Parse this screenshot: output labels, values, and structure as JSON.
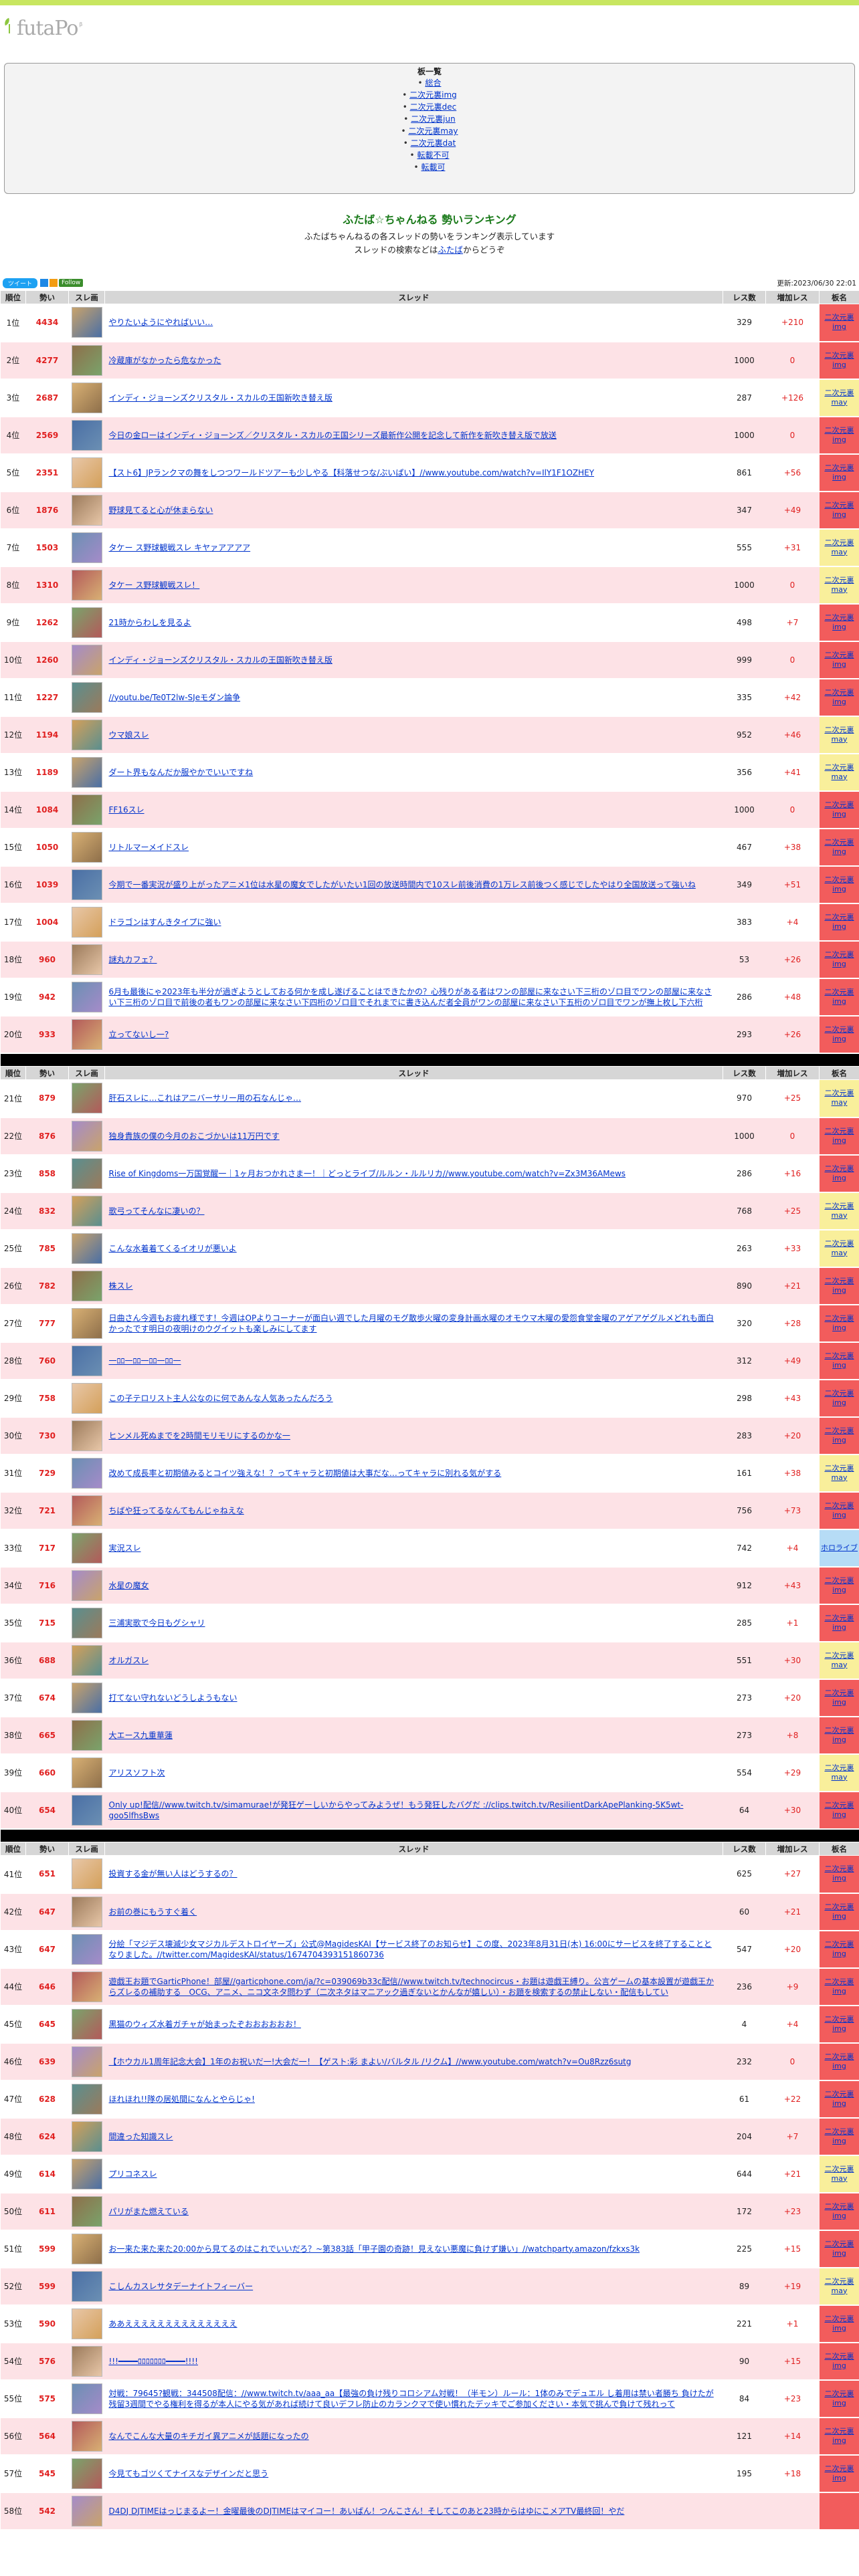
{
  "logo": {
    "text": "futaPo",
    "dev": "β"
  },
  "menu": {
    "title": "板一覧",
    "items": [
      "総合",
      "二次元裏img",
      "二次元裏dec",
      "二次元裏jun",
      "二次元裏may",
      "二次元裏dat",
      "転載不可",
      "転載可"
    ]
  },
  "heading": "ふたば☆ちゃんねる 勢いランキング",
  "description": [
    "ふたばちゃんねるの各スレッドの勢いをランキング表示しています",
    "スレッドの検索などは",
    "ふたば",
    "からどうぞ"
  ],
  "share": {
    "tweet": "ツイート",
    "follow": "Follow"
  },
  "updated": "更新:2023/06/30 22:01",
  "columns": [
    "順位",
    "勢い",
    "スレ画",
    "スレッド",
    "レス数",
    "増加レス",
    "板名"
  ],
  "rows": [
    {
      "rank": "1位",
      "score": "4434",
      "title": "やりたいようにやればいい…",
      "res": "329",
      "inc": "+210",
      "board": "二次元裏img",
      "color": "red"
    },
    {
      "rank": "2位",
      "score": "4277",
      "title": "冷蔵庫がなかったら危なかった",
      "res": "1000",
      "inc": "0",
      "board": "二次元裏img",
      "color": "red"
    },
    {
      "rank": "3位",
      "score": "2687",
      "title": "インディ・ジョーンズクリスタル・スカルの王国新吹き替え版",
      "res": "287",
      "inc": "+126",
      "board": "二次元裏may",
      "color": "yel"
    },
    {
      "rank": "4位",
      "score": "2569",
      "title": "今日の金ローはインディ・ジョーンズ／クリスタル・スカルの王国シリーズ最新作公開を記念して新作を新吹き替え版で放送",
      "res": "1000",
      "inc": "0",
      "board": "二次元裏img",
      "color": "red"
    },
    {
      "rank": "5位",
      "score": "2351",
      "title": "【スト6】JPランクマの舞をしつつワールドツアーも少しやる【科落せつな/ぶいぱい】//www.youtube.com/watch?v=IlY1F1OZHEY",
      "res": "861",
      "inc": "+56",
      "board": "二次元裏img",
      "color": "red"
    },
    {
      "rank": "6位",
      "score": "1876",
      "title": "野球見てると心が休まらない",
      "res": "347",
      "inc": "+49",
      "board": "二次元裏img",
      "color": "red"
    },
    {
      "rank": "7位",
      "score": "1503",
      "title": "タケー ス野球観戦スレ キヤァアアアア",
      "res": "555",
      "inc": "+31",
      "board": "二次元裏may",
      "color": "yel"
    },
    {
      "rank": "8位",
      "score": "1310",
      "title": "タケー ス野球観戦スレ！",
      "res": "1000",
      "inc": "0",
      "board": "二次元裏may",
      "color": "yel"
    },
    {
      "rank": "9位",
      "score": "1262",
      "title": "21時からわしを見るよ",
      "res": "498",
      "inc": "+7",
      "board": "二次元裏img",
      "color": "red"
    },
    {
      "rank": "10位",
      "score": "1260",
      "title": "インディ・ジョーンズクリスタル・スカルの王国新吹き替え版",
      "res": "999",
      "inc": "0",
      "board": "二次元裏img",
      "color": "red"
    },
    {
      "rank": "11位",
      "score": "1227",
      "title": "//youtu.be/Te0T2lw-SJeモダン論争",
      "res": "335",
      "inc": "+42",
      "board": "二次元裏img",
      "color": "red"
    },
    {
      "rank": "12位",
      "score": "1194",
      "title": "ウマ娘スレ",
      "res": "952",
      "inc": "+46",
      "board": "二次元裏may",
      "color": "yel"
    },
    {
      "rank": "13位",
      "score": "1189",
      "title": "ダート界もなんだか服やかでいいですね",
      "res": "356",
      "inc": "+41",
      "board": "二次元裏may",
      "color": "yel"
    },
    {
      "rank": "14位",
      "score": "1084",
      "title": "FF16スレ",
      "res": "1000",
      "inc": "0",
      "board": "二次元裏img",
      "color": "red"
    },
    {
      "rank": "15位",
      "score": "1050",
      "title": "リトルマーメイドスレ",
      "res": "467",
      "inc": "+38",
      "board": "二次元裏img",
      "color": "red"
    },
    {
      "rank": "16位",
      "score": "1039",
      "title": "今期で一番実況が盛り上がったアニメ1位は水星の魔女でしたがいたい1回の放送時間内で10スレ前後消費の1万レス前後つく感じでしたやはり全国放送って強いね",
      "res": "349",
      "inc": "+51",
      "board": "二次元裏img",
      "color": "red"
    },
    {
      "rank": "17位",
      "score": "1004",
      "title": "ドラゴンはすんきタイプに強い",
      "res": "383",
      "inc": "+4",
      "board": "二次元裏img",
      "color": "red"
    },
    {
      "rank": "18位",
      "score": "960",
      "title": "謎丸カフェ？",
      "res": "53",
      "inc": "+26",
      "board": "二次元裏img",
      "color": "red"
    },
    {
      "rank": "19位",
      "score": "942",
      "title": "6月も最後にゃ2023年も半分が過ぎようとしておる何かを成し遂げることはできたかの？心残りがある者はワンの部屋に来なさい下三桁のゾロ目でワンの部屋に来なさい下三桁のゾロ目で前後の者もワンの部屋に来なさい下四桁のゾロ目でそれまでに書き込んだ者全員がワンの部屋に来なさい下五桁のゾロ目でワンが撫上枚し下六桁",
      "res": "286",
      "inc": "+48",
      "board": "二次元裏img",
      "color": "red"
    },
    {
      "rank": "20位",
      "score": "933",
      "title": "立ってないし一?",
      "res": "293",
      "inc": "+26",
      "board": "二次元裏img",
      "color": "red"
    },
    {
      "rank": "21位",
      "score": "879",
      "title": "肝石スレに…これはアニバーサリー用の石なんじゃ…",
      "res": "970",
      "inc": "+25",
      "board": "二次元裏may",
      "color": "yel"
    },
    {
      "rank": "22位",
      "score": "876",
      "title": "独身貴族の僕の今月のおこづかいは11万円です",
      "res": "1000",
      "inc": "0",
      "board": "二次元裏img",
      "color": "red"
    },
    {
      "rank": "23位",
      "score": "858",
      "title": "Rise of Kingdoms一万国覚醒一｜1ヶ月おつかれさま一！｜どっとライブ/ルルン・ルルリカ//www.youtube.com/watch?v=Zx3M36AMews",
      "res": "286",
      "inc": "+16",
      "board": "二次元裏img",
      "color": "red"
    },
    {
      "rank": "24位",
      "score": "832",
      "title": "歌弓ってそんなに凄いの？",
      "res": "768",
      "inc": "+25",
      "board": "二次元裏may",
      "color": "yel"
    },
    {
      "rank": "25位",
      "score": "785",
      "title": "こんな水着着てくるイオリが悪いよ",
      "res": "263",
      "inc": "+33",
      "board": "二次元裏may",
      "color": "yel"
    },
    {
      "rank": "26位",
      "score": "782",
      "title": "株スレ",
      "res": "890",
      "inc": "+21",
      "board": "二次元裏img",
      "color": "red"
    },
    {
      "rank": "27位",
      "score": "777",
      "title": "日曲さん今週もお疲れ様です！今週はOPよりコーナーが面白い週でした月曜のモグ散歩火曜の変身計画水曜のオモウマ木曜の愛怨食堂金曜のアゲアゲグルメどれも面白かったです明日の夜明けのウグイットも楽しみにしてます",
      "res": "320",
      "inc": "+28",
      "board": "二次元裏img",
      "color": "red"
    },
    {
      "rank": "28位",
      "score": "760",
      "title": "一ﾛﾛ一ﾛﾛ一ﾛﾛ一ﾛﾛ一",
      "res": "312",
      "inc": "+49",
      "board": "二次元裏img",
      "color": "red"
    },
    {
      "rank": "29位",
      "score": "758",
      "title": "この子テロリスト主人公なのに何であんな人気あったんだろう",
      "res": "298",
      "inc": "+43",
      "board": "二次元裏img",
      "color": "red"
    },
    {
      "rank": "30位",
      "score": "730",
      "title": "ヒンメル死ぬまでを2時間モリモリにするのかな一",
      "res": "283",
      "inc": "+20",
      "board": "二次元裏img",
      "color": "red"
    },
    {
      "rank": "31位",
      "score": "729",
      "title": "改めて成長率と初期値みるとコイツ強えな！？ってキャラと初期値は大事だな…ってキャラに別れる気がする",
      "res": "161",
      "inc": "+38",
      "board": "二次元裏may",
      "color": "yel"
    },
    {
      "rank": "32位",
      "score": "721",
      "title": "ちばや狂ってるなんてもんじゃねえな",
      "res": "756",
      "inc": "+73",
      "board": "二次元裏img",
      "color": "red"
    },
    {
      "rank": "33位",
      "score": "717",
      "title": "実況スレ",
      "res": "742",
      "inc": "+4",
      "board": "ホロライブ",
      "color": "blu"
    },
    {
      "rank": "34位",
      "score": "716",
      "title": "水星の魔女",
      "res": "912",
      "inc": "+43",
      "board": "二次元裏img",
      "color": "red"
    },
    {
      "rank": "35位",
      "score": "715",
      "title": "三浦実歌で今日もグシャリ",
      "res": "285",
      "inc": "+1",
      "board": "二次元裏img",
      "color": "red"
    },
    {
      "rank": "36位",
      "score": "688",
      "title": "オルガスレ",
      "res": "551",
      "inc": "+30",
      "board": "二次元裏may",
      "color": "yel"
    },
    {
      "rank": "37位",
      "score": "674",
      "title": "打てない守れないどうしようもない",
      "res": "273",
      "inc": "+20",
      "board": "二次元裏img",
      "color": "red"
    },
    {
      "rank": "38位",
      "score": "665",
      "title": "大エース九重華蓮",
      "res": "273",
      "inc": "+8",
      "board": "二次元裏img",
      "color": "red"
    },
    {
      "rank": "39位",
      "score": "660",
      "title": "アリスソフト次",
      "res": "554",
      "inc": "+29",
      "board": "二次元裏may",
      "color": "yel"
    },
    {
      "rank": "40位",
      "score": "654",
      "title": "Only up!配信//www.twitch.tv/simamurae!が発狂ゲーしいからやってみようぜ！もう発狂したバグだ ://clips.twitch.tv/ResilientDarkApePlanking-5K5wt-goo5lfhsBws",
      "res": "64",
      "inc": "+30",
      "board": "二次元裏img",
      "color": "red"
    },
    {
      "rank": "41位",
      "score": "651",
      "title": "投資する金が無い人はどうするの？",
      "res": "625",
      "inc": "+27",
      "board": "二次元裏img",
      "color": "red"
    },
    {
      "rank": "42位",
      "score": "647",
      "title": "お前の巻にもうすぐ着く",
      "res": "60",
      "inc": "+21",
      "board": "二次元裏img",
      "color": "red"
    },
    {
      "rank": "43位",
      "score": "647",
      "title": "分絵「マジデス壊滅少女マジカルデストロイヤーズ」公式@MagidesKAI【サービス終了のお知らせ】この度、2023年8月31日(木) 16:00にサービスを終了することとなりました。//twitter.com/MagidesKAI/status/1674704393151860736",
      "res": "547",
      "inc": "+20",
      "board": "二次元裏img",
      "color": "red"
    },
    {
      "rank": "44位",
      "score": "646",
      "title": "遊戯王お題でGarticPhone！部屋//garticphone.com/ja/?c=039069b33c配信//www.twitch.tv/technocircus・お題は遊戯王縛り。公言ゲームの基本設置が遊戯王からズレるの補助する　OCG、アニメ、ニコ文ネタ問わず（二次ネタはマニアック過ぎないとかんなが嬉しい）・お題を検索するの禁止しない・配信もしてい",
      "res": "236",
      "inc": "+9",
      "board": "二次元裏img",
      "color": "red"
    },
    {
      "rank": "45位",
      "score": "645",
      "title": "黒猫のウィズ水着ガチャが始まったぞおおおおおお！",
      "res": "4",
      "inc": "+4",
      "board": "二次元裏img",
      "color": "red"
    },
    {
      "rank": "46位",
      "score": "639",
      "title": "【ホウカル1周年記念大会】1年のお祝いだ一!大会だ一！【ゲスト:彩 まよい/バルタル /リクム】//www.youtube.com/watch?v=Ou8Rzz6sutg",
      "res": "232",
      "inc": "0",
      "board": "二次元裏img",
      "color": "red"
    },
    {
      "rank": "47位",
      "score": "628",
      "title": "ほれほれ!!隊の居処間になんとやらじゃ!",
      "res": "61",
      "inc": "+22",
      "board": "二次元裏img",
      "color": "red"
    },
    {
      "rank": "48位",
      "score": "624",
      "title": "間違った知識スレ",
      "res": "204",
      "inc": "+7",
      "board": "二次元裏img",
      "color": "red"
    },
    {
      "rank": "49位",
      "score": "614",
      "title": "プリコネスレ",
      "res": "644",
      "inc": "+21",
      "board": "二次元裏may",
      "color": "yel"
    },
    {
      "rank": "50位",
      "score": "611",
      "title": "パリがまた燃えている",
      "res": "172",
      "inc": "+23",
      "board": "二次元裏img",
      "color": "red"
    },
    {
      "rank": "51位",
      "score": "599",
      "title": "お一来た来た来た20:00から見てるのはこれでいいだろ？~第383話「甲子園の奇跡！見えない悪魔に負けず嫌い」//watchparty.amazon/fzkxs3k",
      "res": "225",
      "inc": "+15",
      "board": "二次元裏img",
      "color": "red"
    },
    {
      "rank": "52位",
      "score": "599",
      "title": "こしんカスレサタデーナイトフィーバー",
      "res": "89",
      "inc": "+19",
      "board": "二次元裏may",
      "color": "yel"
    },
    {
      "rank": "53位",
      "score": "590",
      "title": "ああええええええええええええええ",
      "res": "221",
      "inc": "+1",
      "board": "二次元裏img",
      "color": "red"
    },
    {
      "rank": "54位",
      "score": "576",
      "title": "!!!━━━━ﾛﾛﾛﾛﾛﾛﾛ━━━━!!!!",
      "res": "90",
      "inc": "+15",
      "board": "二次元裏img",
      "color": "red"
    },
    {
      "rank": "55位",
      "score": "575",
      "title": "対戦：79645?観戦：344508配信：//www.twitch.tv/aaa_aa【最強の負け残りコロシアム対戦！（半モン）ルール：1体のみでデュエル し着用は禁い者勝ち 負けたが残留3週間でやる権利を得るが本人にやる気があれば続けて良いデフレ防止のカランクマで使い慣れたデッキでご参加ください・本気で挑んで負けて残れって",
      "res": "84",
      "inc": "+23",
      "board": "二次元裏img",
      "color": "red"
    },
    {
      "rank": "56位",
      "score": "564",
      "title": "なんでこんな大量のキチガイ異アニメが話題になったの",
      "res": "121",
      "inc": "+14",
      "board": "二次元裏img",
      "color": "red"
    },
    {
      "rank": "57位",
      "score": "545",
      "title": "今見てもゴツくてナイスなデザインだと思う",
      "res": "195",
      "inc": "+18",
      "board": "二次元裏img",
      "color": "red"
    },
    {
      "rank": "58位",
      "score": "542",
      "title": "D4DJ DJTIMEはっじまるよー！金曜最後のDJTIMEはマイコー！あいばん！つんこさん！そしてこのあと23時からはゆにこメアTV最終回！やだ",
      "res": "",
      "inc": "",
      "board": "",
      "color": "red"
    }
  ]
}
